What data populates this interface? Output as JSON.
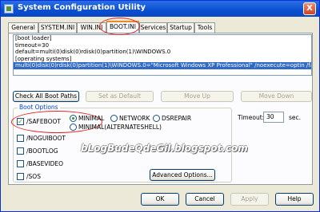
{
  "window": {
    "title": "System Configuration Utility",
    "close_glyph": "X"
  },
  "tabs": [
    {
      "label": "General"
    },
    {
      "label": "SYSTEM.INI"
    },
    {
      "label": "WIN.INI"
    },
    {
      "label": "BOOT.INI",
      "active": true
    },
    {
      "label": "Services"
    },
    {
      "label": "Startup"
    },
    {
      "label": "Tools"
    }
  ],
  "boot_ini": {
    "lines": [
      "[boot loader]",
      "timeout=30",
      "default=multi(0)disk(0)rdisk(0)partition(1)\\WINDOWS.0",
      "[operating systems]",
      "multi(0)disk(0)rdisk(0)partition(1)\\WINDOWS.0=\"Microsoft Windows XP Professional\" /noexecute=optin /fastdet"
    ],
    "selected_index": 4
  },
  "buttons": {
    "check_all": "Check All Boot Paths",
    "set_default": "Set as Default",
    "move_up": "Move Up",
    "move_down": "Move Down",
    "advanced": "Advanced Options...",
    "ok": "OK",
    "cancel": "Cancel",
    "apply": "Apply",
    "help": "Help"
  },
  "boot_options": {
    "group_label": "Boot Options",
    "safeboot": {
      "label": "/SAFEBOOT",
      "checked": true
    },
    "radios": {
      "minimal": {
        "label": "MINIMAL",
        "selected": true
      },
      "network": {
        "label": "NETWORK",
        "selected": false
      },
      "dsrepair": {
        "label": "DSREPAIR",
        "selected": false
      },
      "alternateshell": {
        "label": "MINIMAL(ALTERNATESHELL)",
        "selected": false
      }
    },
    "noguiboot": {
      "label": "/NOGUIBOOT",
      "checked": false
    },
    "bootlog": {
      "label": "/BOOTLOG",
      "checked": false
    },
    "basevideo": {
      "label": "/BASEVIDEO",
      "checked": false
    },
    "sos": {
      "label": "/SOS",
      "checked": false
    }
  },
  "timeout": {
    "label": "Timeout:",
    "value": "30",
    "unit": "sec."
  },
  "watermark": "bLogBudeQdeGil.blogspot.com",
  "colors": {
    "titlebar": "#0a4fd0",
    "selection": "#316ac5",
    "annotation_red": "#e4201e",
    "group_label": "#0046d5"
  }
}
